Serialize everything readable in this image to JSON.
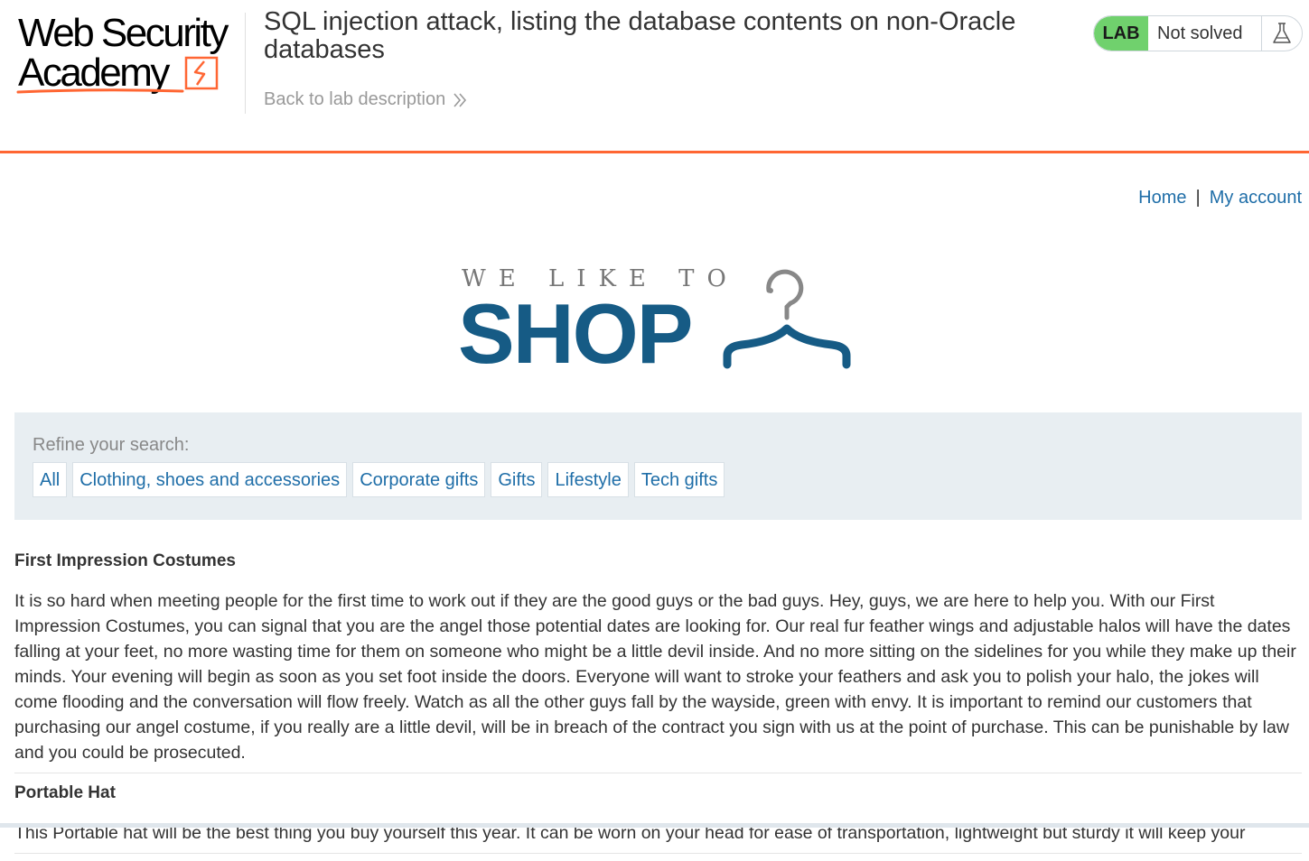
{
  "academy": {
    "logo_line1": "Web Security",
    "logo_line2": "Academy",
    "lab_title": "SQL injection attack, listing the database contents on non-Oracle databases",
    "back_link": "Back to lab description",
    "lab_badge": "LAB",
    "lab_status": "Not solved",
    "icons": {
      "back": "double-chevron-right-icon",
      "flask": "flask-icon"
    },
    "colors": {
      "accent": "#ff6633",
      "badge": "#70d16d"
    }
  },
  "nav": {
    "home": "Home",
    "separator": "|",
    "my_account": "My account"
  },
  "shop_logo": {
    "tagline": "WE LIKE TO",
    "word": "SHOP",
    "icon": "hanger-icon",
    "color": "#165b85"
  },
  "filter": {
    "label": "Refine your search:",
    "categories": [
      "All",
      "Clothing, shoes and accessories",
      "Corporate gifts",
      "Gifts",
      "Lifestyle",
      "Tech gifts"
    ]
  },
  "products": [
    {
      "name": "First Impression Costumes",
      "description": "It is so hard when meeting people for the first time to work out if they are the good guys or the bad guys. Hey, guys, we are here to help you. With our First Impression Costumes, you can signal that you are the angel those potential dates are looking for. Our real fur feather wings and adjustable halos will have the dates falling at your feet, no more wasting time for them on someone who might be a little devil inside. And no more sitting on the sidelines for you while they make up their minds. Your evening will begin as soon as you set foot inside the doors. Everyone will want to stroke your feathers and ask you to polish your halo, the jokes will come flooding and the conversation will flow freely. Watch as all the other guys fall by the wayside, green with envy. It is important to remind our customers that purchasing our angel costume, if you really are a little devil, will be in breach of the contract you sign with us at the point of purchase. This can be punishable by law and you could be prosecuted."
    },
    {
      "name": "Portable Hat",
      "description": "This Portable hat will be the best thing you buy yourself this year. It can be worn on your head for ease of transportation, lightweight but sturdy it will keep your"
    }
  ]
}
